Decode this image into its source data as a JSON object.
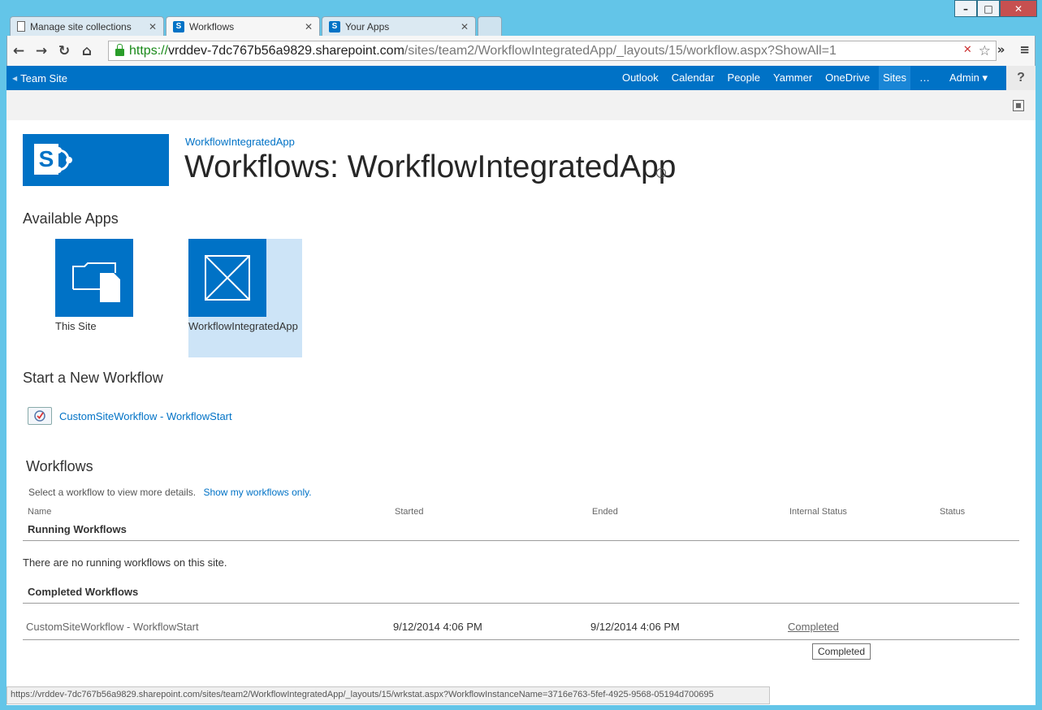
{
  "browser": {
    "tabs": [
      {
        "label": "Manage site collections",
        "icon": "page-icon"
      },
      {
        "label": "Workflows",
        "icon": "sharepoint-icon"
      },
      {
        "label": "Your Apps",
        "icon": "sharepoint-icon"
      }
    ],
    "url": {
      "scheme": "https://",
      "host": "vrddev-7dc767b56a9829.sharepoint.com",
      "path": "/sites/team2/WorkflowIntegratedApp/_layouts/15/workflow.aspx?ShowAll=1"
    },
    "status_url": "https://vrddev-7dc767b56a9829.sharepoint.com/sites/team2/WorkflowIntegratedApp/_layouts/15/wrkstat.aspx?WorkflowInstanceName=3716e763-5fef-4925-9568-05194d700695"
  },
  "suitebar": {
    "site_link": "Team Site",
    "links": [
      "Outlook",
      "Calendar",
      "People",
      "Yammer",
      "OneDrive",
      "Sites",
      "…"
    ],
    "selected": "Sites",
    "admin": "Admin ▾",
    "help": "?"
  },
  "header": {
    "breadcrumb": "WorkflowIntegratedApp",
    "title": "Workflows: WorkflowIntegratedApp"
  },
  "available_apps": {
    "heading": "Available Apps",
    "items": [
      {
        "label": "This Site"
      },
      {
        "label": "WorkflowIntegratedApp"
      }
    ]
  },
  "start_workflow": {
    "heading": "Start a New Workflow",
    "item": "CustomSiteWorkflow - WorkflowStart"
  },
  "workflows": {
    "heading": "Workflows",
    "hint": "Select a workflow to view more details.",
    "show_mine": "Show my workflows only.",
    "columns": [
      "Name",
      "Started",
      "Ended",
      "Internal Status",
      "Status"
    ],
    "running_heading": "Running Workflows",
    "running_empty": "There are no running workflows on this site.",
    "completed_heading": "Completed Workflows",
    "completed_rows": [
      {
        "name": "CustomSiteWorkflow - WorkflowStart",
        "started": "9/12/2014 4:06 PM",
        "ended": "9/12/2014 4:06 PM",
        "internal_status": "Completed",
        "status": ""
      }
    ],
    "tooltip": "Completed"
  }
}
